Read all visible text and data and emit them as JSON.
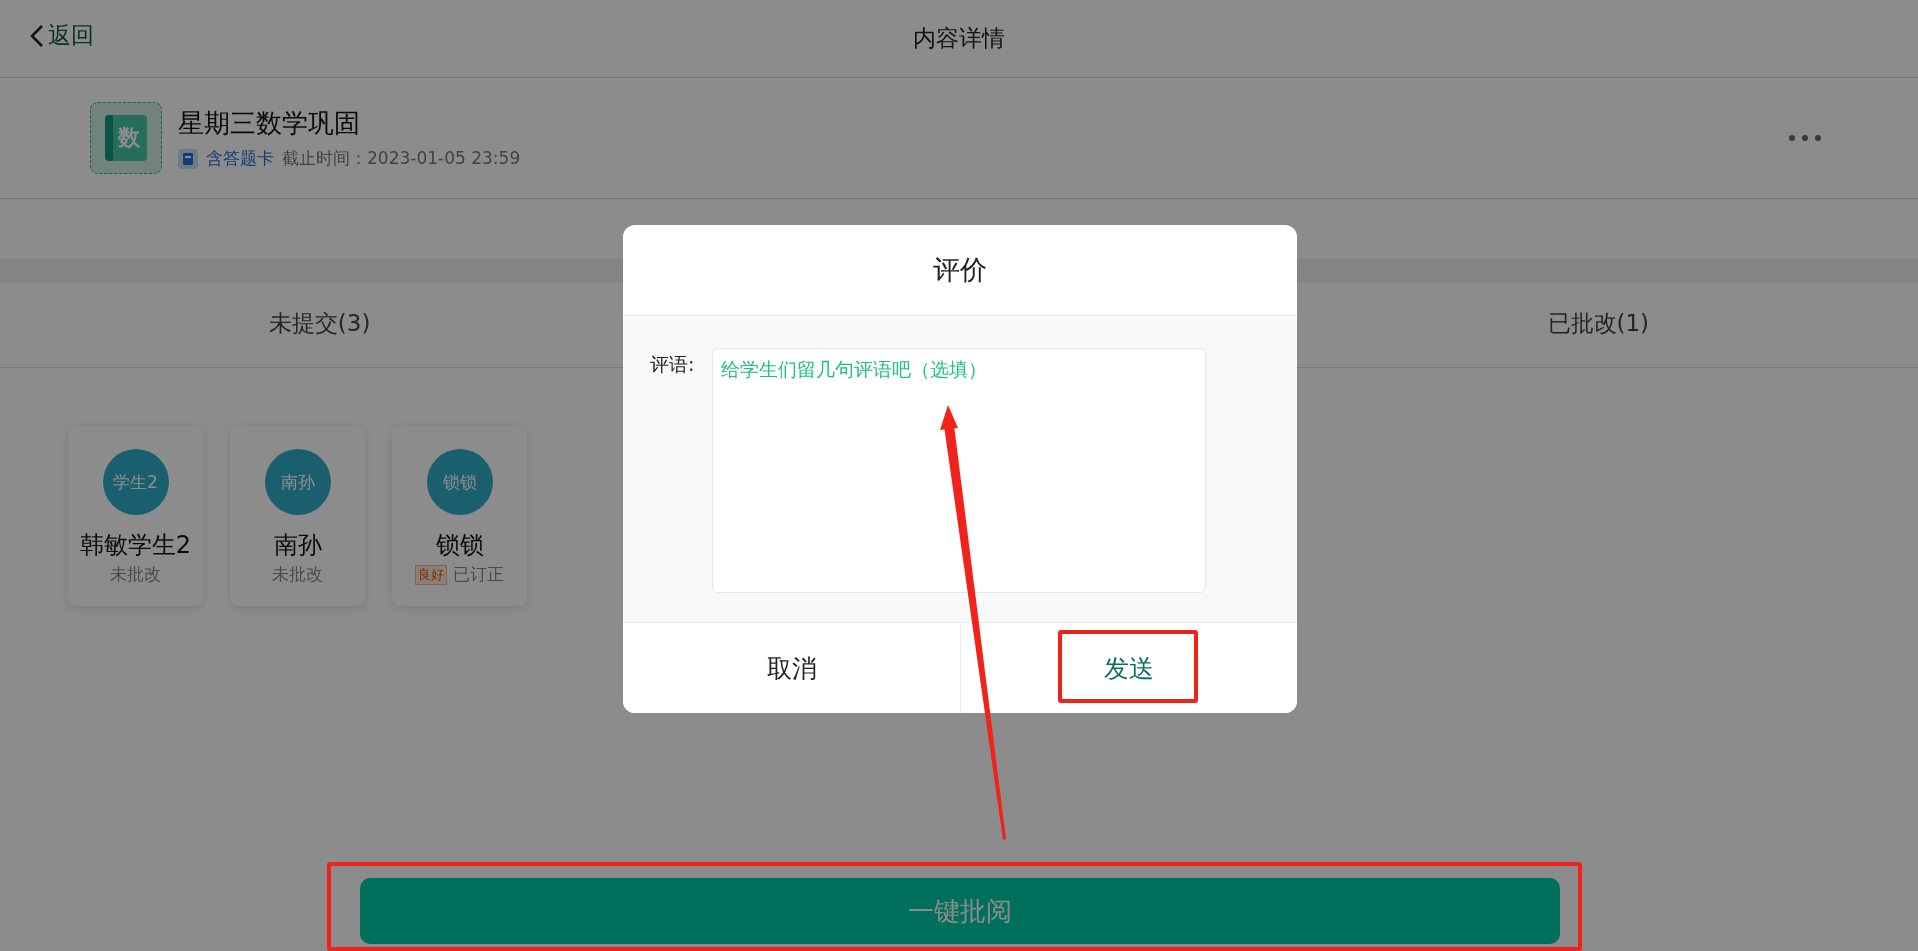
{
  "header": {
    "back": "返回",
    "title": "内容详情"
  },
  "assignment": {
    "icon_text": "数",
    "title": "星期三数学巩固",
    "tag": "含答题卡",
    "deadline": "截止时间：2023-01-05 23:59"
  },
  "tabs": [
    {
      "label": "未提交(3)",
      "selected": false
    },
    {
      "label": "已批改(1)",
      "selected": false
    }
  ],
  "students": [
    {
      "avatar": "学生2",
      "name": "韩敏学生2",
      "status": "未批改"
    },
    {
      "avatar": "南孙",
      "name": "南孙",
      "status": "未批改"
    },
    {
      "avatar": "锁锁",
      "name": "锁锁",
      "grade": "良好",
      "status": "已订正"
    }
  ],
  "dialog": {
    "title": "评价",
    "label": "评语:",
    "placeholder": "给学生们留几句评语吧（选填）",
    "buttons": [
      {
        "label": "取消",
        "kind": "cancel"
      },
      {
        "label": "发送",
        "kind": "confirm"
      }
    ]
  },
  "action_button": "一键批阅"
}
